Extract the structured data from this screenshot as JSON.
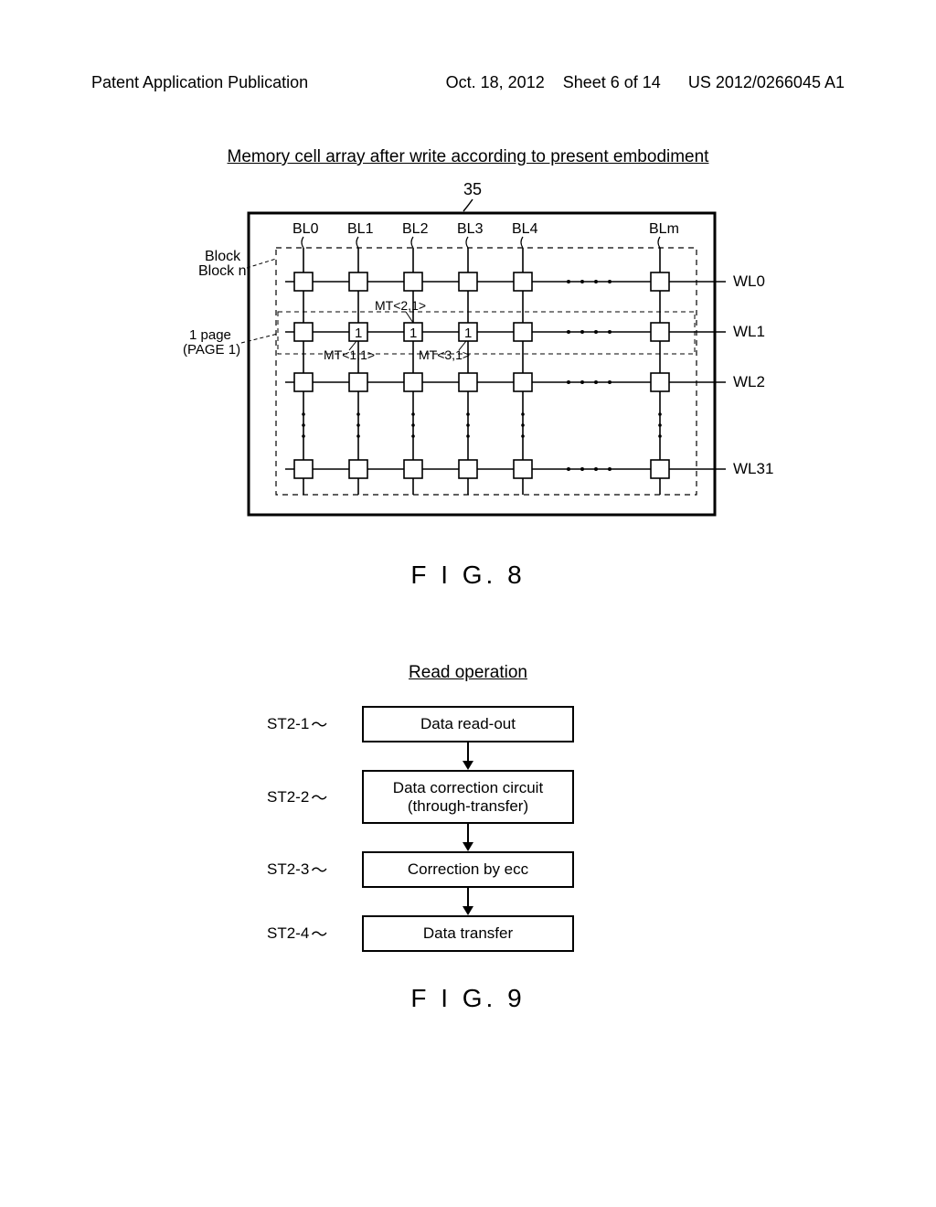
{
  "header": {
    "left": "Patent Application Publication",
    "date": "Oct. 18, 2012",
    "sheet": "Sheet 6 of 14",
    "pubnum": "US 2012/0266045 A1"
  },
  "fig8": {
    "title": "Memory cell array after write according to present embodiment",
    "ref_num": "35",
    "block_label_1": "Block",
    "block_label_2": "Block n",
    "page_label_1": "1 page",
    "page_label_2": "(PAGE 1)",
    "bit_lines": [
      "BL0",
      "BL1",
      "BL2",
      "BL3",
      "BL4",
      "BLm"
    ],
    "word_lines": [
      "WL0",
      "WL1",
      "WL2",
      "WL31"
    ],
    "mt_labels": {
      "m21": "MT<2,1>",
      "m11": "MT<1,1>",
      "m31": "MT<3,1>"
    },
    "programmed_cells": [
      "1",
      "1",
      "1"
    ],
    "caption": "F I G. 8"
  },
  "fig9": {
    "title": "Read operation",
    "steps": [
      {
        "label": "ST2-1",
        "text": "Data read-out"
      },
      {
        "label": "ST2-2",
        "text": "Data correction circuit\n(through-transfer)"
      },
      {
        "label": "ST2-3",
        "text": "Correction by ecc"
      },
      {
        "label": "ST2-4",
        "text": "Data transfer"
      }
    ],
    "caption": "F I G. 9"
  }
}
